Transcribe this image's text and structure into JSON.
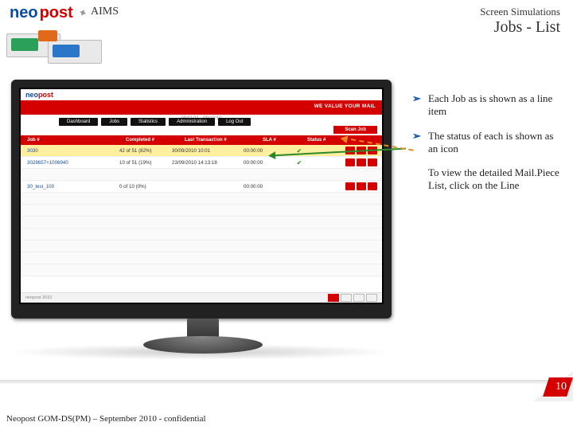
{
  "brand": {
    "neo": "neo",
    "post": "post"
  },
  "header": {
    "aims": "AIMS",
    "screen_sim": "Screen Simulations",
    "title": "Jobs - List"
  },
  "monitor": {
    "slogan": "WE VALUE YOUR MAIL",
    "tabs": [
      "Dashboard",
      "Jobs",
      "Statistics",
      "Administration",
      "Log Out"
    ],
    "date_label": "09/11/11 - 09/10/10",
    "scan_btn": "Scan Job",
    "columns": {
      "job": "Job #",
      "completed": "Completed #",
      "transaction": "Last Transaction #",
      "sla": "SLA #",
      "status": "Status #"
    },
    "rows": [
      {
        "job": "3030",
        "completed": "42 of 51 (82%)",
        "transaction": "30/09/2010 10:01",
        "sla": "00:00:00",
        "status": "✔",
        "selected": true
      },
      {
        "job": "3028657+1006940",
        "completed": "10 of 51 (19%)",
        "transaction": "23/09/2010 14:13:18",
        "sla": "00:00:00",
        "status": "✔",
        "selected": false
      },
      {
        "job": "30_test_100",
        "completed": "0 of 10 (0%)",
        "transaction": "",
        "sla": "00:00:00",
        "status": "",
        "selected": false
      }
    ],
    "footer_label": "neopost 2010"
  },
  "bullets": [
    "Each Job as is shown as a line item",
    "The status of each is shown as an icon",
    "To view the detailed Mail.Piece List, click on the Line"
  ],
  "page_number": "10",
  "footer": "Neopost GOM-DS(PM) – September 2010 - confidential"
}
